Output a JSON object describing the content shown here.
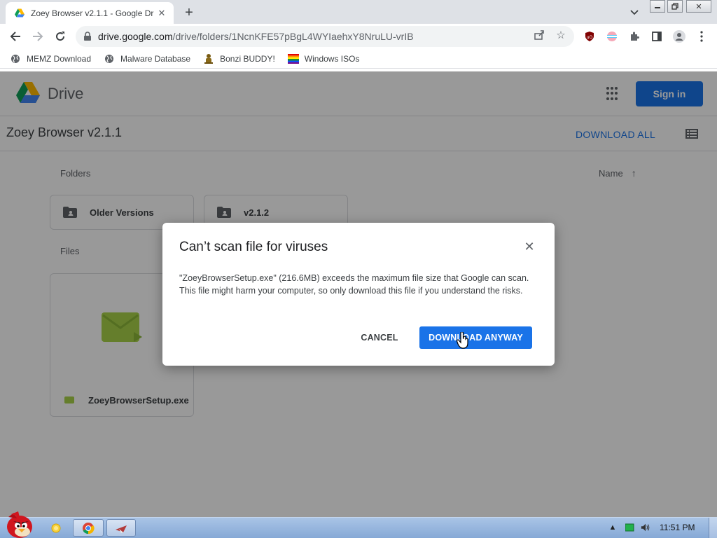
{
  "browser": {
    "tab": {
      "title": "Zoey Browser v2.1.1 - Google Dr"
    },
    "url": {
      "host": "drive.google.com",
      "path": "/drive/folders/1NcnKFE57pBgL4WYIaehxY8NruLU-vrIB"
    },
    "bookmarks": [
      {
        "label": "MEMZ Download",
        "icon": "globe-icon"
      },
      {
        "label": "Malware Database",
        "icon": "globe-icon"
      },
      {
        "label": "Bonzi BUDDY!",
        "icon": "bonzi-icon"
      },
      {
        "label": "Windows ISOs",
        "icon": "windows-flag-icon"
      }
    ]
  },
  "drive": {
    "app_name": "Drive",
    "sign_in_label": "Sign in",
    "folder_title": "Zoey Browser v2.1.1",
    "download_all_label": "DOWNLOAD ALL",
    "folders_label": "Folders",
    "files_label": "Files",
    "sort_label": "Name",
    "folders": [
      {
        "name": "Older Versions"
      },
      {
        "name": "v2.1.2"
      }
    ],
    "files": [
      {
        "name": "ZoeyBrowserSetup.exe"
      }
    ]
  },
  "dialog": {
    "title": "Can’t scan file for viruses",
    "body": "\"ZoeyBrowserSetup.exe\" (216.6MB) exceeds the maximum file size that Google can scan. This file might harm your computer, so only download this file if you understand the risks.",
    "cancel_label": "CANCEL",
    "download_label": "DOWNLOAD ANYWAY"
  },
  "taskbar": {
    "clock": "11:51 PM"
  },
  "colors": {
    "accent": "#1a73e8",
    "taskbar": "#a9c4e6"
  }
}
